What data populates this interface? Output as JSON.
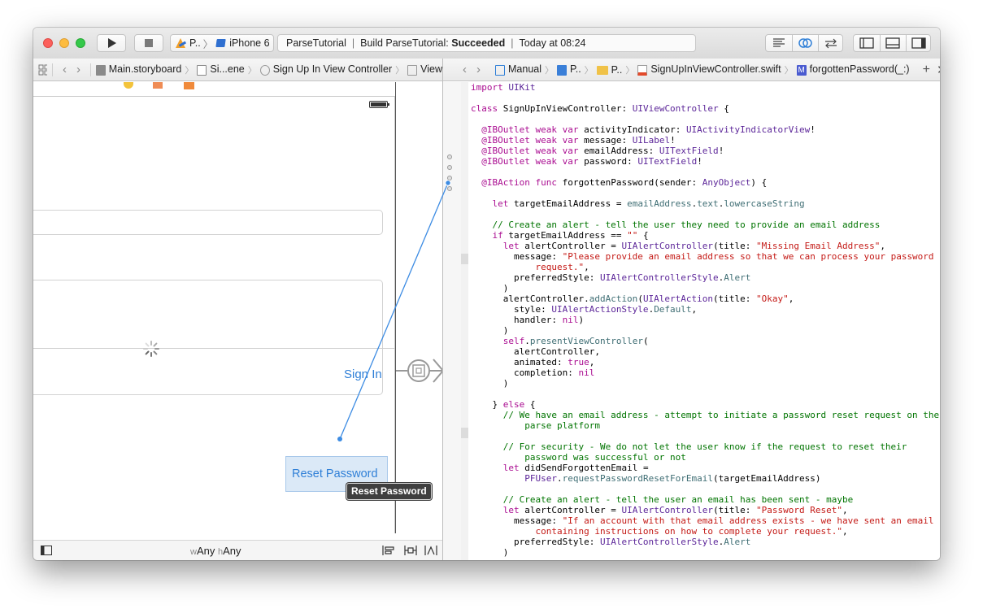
{
  "toolbar": {
    "scheme_project": "P..",
    "scheme_device": "iPhone 6",
    "status_project": "ParseTutorial",
    "status_build_prefix": "Build ParseTutorial:",
    "status_build_result": "Succeeded",
    "status_time": "Today at 08:24"
  },
  "left_jump_bar": {
    "items": [
      "Main.storyboard",
      "Si...ene",
      "Sign Up In View Controller",
      "View"
    ]
  },
  "right_jump_bar": {
    "mode": "Manual",
    "items": [
      "P..",
      "P..",
      "SignUpInViewController.swift",
      "forgottenPassword(_:)"
    ]
  },
  "canvas": {
    "sign_in_label": "Sign In",
    "reset_password_label": "Reset Password",
    "connection_tooltip": "Reset Password",
    "size_class": {
      "w_prefix": "w",
      "w_value": "Any",
      "h_prefix": "h",
      "h_value": "Any"
    }
  },
  "editor": {
    "language": "Swift",
    "code_lines": [
      "import UIKit",
      "",
      "class SignUpInViewController: UIViewController {",
      "",
      "  @IBOutlet weak var activityIndicator: UIActivityIndicatorView!",
      "  @IBOutlet weak var message: UILabel!",
      "  @IBOutlet weak var emailAddress: UITextField!",
      "  @IBOutlet weak var password: UITextField!",
      "",
      "  @IBAction func forgottenPassword(sender: AnyObject) {",
      "",
      "    let targetEmailAddress = emailAddress.text.lowercaseString",
      "",
      "    // Create an alert - tell the user they need to provide an email address",
      "    if targetEmailAddress == \"\" {",
      "      let alertController = UIAlertController(title: \"Missing Email Address\",",
      "        message: \"Please provide an email address so that we can process your password",
      "            request.\",",
      "        preferredStyle: UIAlertControllerStyle.Alert",
      "      )",
      "      alertController.addAction(UIAlertAction(title: \"Okay\",",
      "        style: UIAlertActionStyle.Default,",
      "        handler: nil)",
      "      )",
      "      self.presentViewController(",
      "        alertController,",
      "        animated: true,",
      "        completion: nil",
      "      )",
      "",
      "    } else {",
      "      // We have an email address - attempt to initiate a password reset request on the",
      "          parse platform",
      "",
      "      // For security - We do not let the user know if the request to reset their",
      "          password was successful or not",
      "      let didSendForgottenEmail =",
      "          PFUser.requestPasswordResetForEmail(targetEmailAddress)",
      "",
      "      // Create an alert - tell the user an email has been sent - maybe",
      "      let alertController = UIAlertController(title: \"Password Reset\",",
      "        message: \"If an account with that email address exists - we have sent an email",
      "            containing instructions on how to complete your request.\",",
      "        preferredStyle: UIAlertControllerStyle.Alert",
      "      )"
    ]
  },
  "colors": {
    "keyword": "#aa0d91",
    "type": "#5c2699",
    "method": "#3f6e74",
    "string": "#c41a16",
    "comment": "#007400",
    "accent_blue": "#2f7fd7",
    "button_bg": "#dbe9f7"
  },
  "icons": [
    "play-icon",
    "stop-icon",
    "xcode-hammer-icon",
    "iphone-icon",
    "editor-standard-icon",
    "editor-assistant-icon",
    "editor-version-icon",
    "navigator-toggle-icon",
    "debug-toggle-icon",
    "utilities-toggle-icon",
    "related-items-icon",
    "back-icon",
    "forward-icon",
    "storyboard-file-icon",
    "scene-icon",
    "view-controller-icon",
    "view-icon",
    "assistant-manual-icon",
    "project-icon",
    "folder-icon",
    "swift-file-icon",
    "method-icon",
    "add-editor-icon",
    "close-editor-icon",
    "battery-icon",
    "activity-indicator-icon",
    "segue-icon",
    "document-outline-icon",
    "stack-icon",
    "pin-icon",
    "resolve-icon"
  ]
}
